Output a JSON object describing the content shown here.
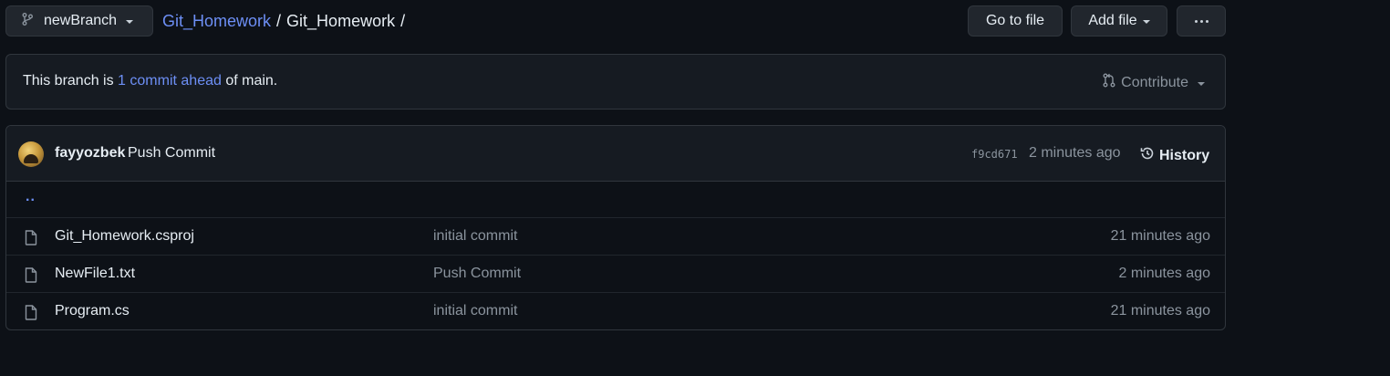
{
  "topbar": {
    "branch_label": "newBranch",
    "breadcrumb_repo": "Git_Homework",
    "breadcrumb_sep1": "/",
    "breadcrumb_dir": "Git_Homework",
    "breadcrumb_sep2": "/",
    "goto_file_label": "Go to file",
    "add_file_label": "Add file"
  },
  "banner": {
    "prefix": "This branch is ",
    "link": "1 commit ahead",
    "suffix": " of main.",
    "contribute_label": "Contribute"
  },
  "latest_commit": {
    "author": "fayyozbek",
    "message": "Push Commit",
    "sha": "f9cd671",
    "time": "2 minutes ago",
    "history_label": "History"
  },
  "parent_link": "..",
  "files": [
    {
      "name": "Git_Homework.csproj",
      "message": "initial commit",
      "time": "21 minutes ago"
    },
    {
      "name": "NewFile1.txt",
      "message": "Push Commit",
      "time": "2 minutes ago"
    },
    {
      "name": "Program.cs",
      "message": "initial commit",
      "time": "21 minutes ago"
    }
  ],
  "colors": {
    "background": "#0d1117",
    "panel": "#161b22",
    "border": "#30363d",
    "link": "#6d8ff5",
    "muted": "#8b949e"
  }
}
